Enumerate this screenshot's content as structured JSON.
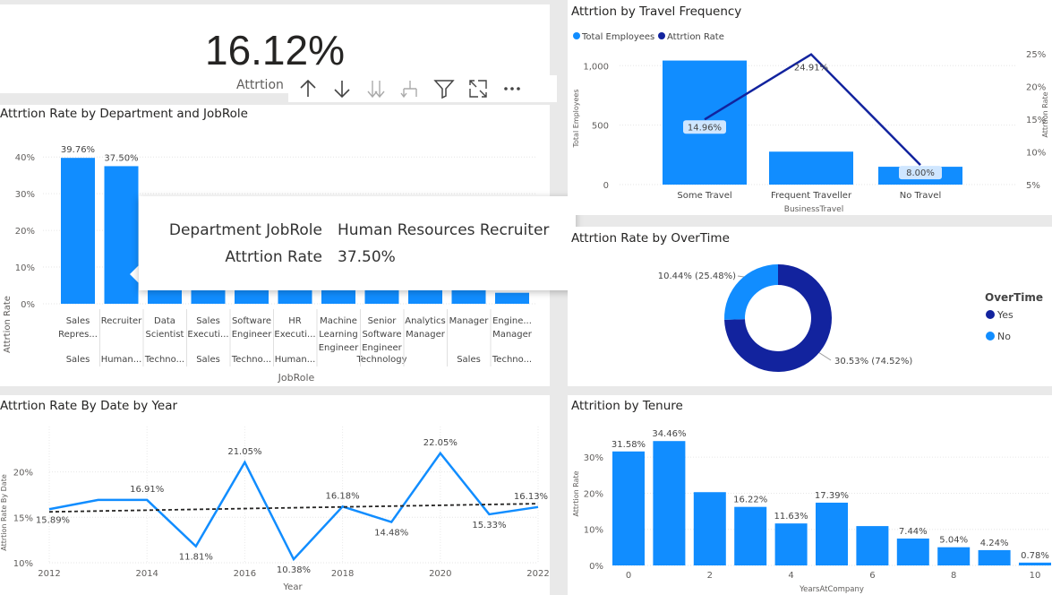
{
  "kpi": {
    "value": "16.12%",
    "label": "Attrtion R"
  },
  "toolbar": {
    "icons": [
      "arrow-up-icon",
      "arrow-down-icon",
      "double-arrow-down-icon",
      "expand-hierarchy-icon",
      "filter-icon",
      "focus-mode-icon",
      "more-options-icon"
    ]
  },
  "dept": {
    "title": "Attrtion Rate by Department and JobRole",
    "yaxis_title": "Attrtion Rate",
    "xaxis_title": "JobRole",
    "yticks": [
      "40%",
      "30%",
      "20%",
      "10%",
      "0%"
    ],
    "roles": [
      [
        "Sales",
        "Repres..."
      ],
      [
        "Recruiter"
      ],
      [
        "Data",
        "Scientist"
      ],
      [
        "Sales",
        "Executi..."
      ],
      [
        "Software",
        "Engineer"
      ],
      [
        "HR",
        "Executi..."
      ],
      [
        "Machine",
        "Learning",
        "Engineer"
      ],
      [
        "Senior",
        "Software",
        "Engineer"
      ],
      [
        "Analytics",
        "Manager"
      ],
      [
        "Manager"
      ],
      [
        "Engine...",
        "Manager"
      ]
    ],
    "departments": [
      "Sales",
      "Human...",
      "Techno...",
      "Sales",
      "Techno...",
      "Human...",
      "",
      "Technology",
      "",
      "Sales",
      "Techno..."
    ],
    "data_labels": [
      "39.76%",
      "37.50%"
    ]
  },
  "tooltip": {
    "key1": "Department JobRole",
    "val1": "Human Resources Recruiter",
    "key2": "Attrtion Rate",
    "val2": "37.50%"
  },
  "travel": {
    "title": "Attrtion by Travel Frequency",
    "legend": [
      "Total Employees",
      "Attrtion Rate"
    ],
    "y1_title": "Total Employees",
    "y2_title": "Attrtion Rate",
    "x_title": "BusinessTravel",
    "y1_ticks": [
      "1,000",
      "500",
      "0"
    ],
    "y2_ticks": [
      "25%",
      "20%",
      "15%",
      "10%",
      "5%"
    ],
    "line_labels": [
      "14.96%",
      "24.91%",
      "8.00%"
    ]
  },
  "overtime": {
    "title": "Attrtion Rate by OverTime",
    "legend_title": "OverTime",
    "legend": [
      "Yes",
      "No"
    ],
    "label_no": "10.44% (25.48%)",
    "label_yes": "30.53% (74.52%)"
  },
  "year": {
    "title": "Attrtion Rate By Date by Year",
    "y_title": "Attrtion Rate By Date",
    "x_title": "Year",
    "yticks": [
      "20%",
      "15%",
      "10%"
    ],
    "xticks": [
      "2012",
      "2014",
      "2016",
      "2018",
      "2020",
      "2022"
    ],
    "point_labels": [
      "15.89%",
      "16.91%",
      "11.81%",
      "21.05%",
      "10.38%",
      "16.18%",
      "14.48%",
      "22.05%",
      "15.33%",
      "16.13%"
    ]
  },
  "tenure": {
    "title": "Attrition by Tenure",
    "y_title": "Attrtion Rate",
    "x_title": "YearsAtCompany",
    "yticks": [
      "30%",
      "20%",
      "10%",
      "0%"
    ],
    "xticks": [
      "0",
      "2",
      "4",
      "6",
      "8",
      "10"
    ],
    "bar_labels": [
      "31.58%",
      "34.46%",
      "",
      "16.22%",
      "11.63%",
      "17.39%",
      "",
      "7.44%",
      "5.04%",
      "4.24%",
      "0.78%"
    ]
  },
  "colors": {
    "bar": "#118dff",
    "dark": "#12239e",
    "trend": "#252423"
  },
  "chart_data": [
    {
      "type": "bar",
      "title": "Attrtion Rate by Department and JobRole",
      "xlabel": "JobRole",
      "ylabel": "Attrtion Rate",
      "categories": [
        "Sales Repres...",
        "Recruiter",
        "Data Scientist",
        "Sales Executi...",
        "Software Engineer",
        "HR Executi...",
        "Machine Learning Engineer",
        "Senior Software Engineer",
        "Analytics Manager",
        "Manager",
        "Engine... Manager"
      ],
      "values": [
        39.76,
        37.5,
        5,
        5,
        5,
        5,
        5,
        5,
        5,
        5,
        3
      ],
      "ylim": [
        0,
        45
      ]
    },
    {
      "type": "bar",
      "title": "Attrtion by Travel Frequency",
      "xlabel": "BusinessTravel",
      "categories": [
        "Some Travel",
        "Frequent Traveller",
        "No Travel"
      ],
      "series": [
        {
          "name": "Total Employees",
          "values": [
            1043,
            277,
            150
          ]
        },
        {
          "name": "Attrtion Rate",
          "values": [
            14.96,
            24.91,
            8.0
          ]
        }
      ],
      "ylim": [
        0,
        1100
      ],
      "y2lim": [
        5,
        27
      ]
    },
    {
      "type": "pie",
      "title": "Attrtion Rate by OverTime",
      "categories": [
        "Yes",
        "No"
      ],
      "values": [
        30.53,
        10.44
      ],
      "percent_of_total": [
        74.52,
        25.48
      ]
    },
    {
      "type": "line",
      "title": "Attrtion Rate By Date by Year",
      "xlabel": "Year",
      "ylabel": "Attrtion Rate By Date",
      "x": [
        2012,
        2013,
        2014,
        2015,
        2016,
        2017,
        2018,
        2019,
        2020,
        2021,
        2022
      ],
      "values": [
        15.89,
        16.91,
        16.91,
        11.81,
        21.05,
        10.38,
        16.18,
        14.48,
        22.05,
        15.33,
        16.13
      ],
      "trend": [
        15.6,
        16.5
      ],
      "ylim": [
        9.5,
        24
      ]
    },
    {
      "type": "bar",
      "title": "Attrition by Tenure",
      "xlabel": "YearsAtCompany",
      "ylabel": "Attrtion Rate",
      "categories": [
        "0",
        "1",
        "2",
        "3",
        "4",
        "5",
        "6",
        "7",
        "8",
        "9",
        "10"
      ],
      "values": [
        31.58,
        34.46,
        20.3,
        16.22,
        11.63,
        17.39,
        10.9,
        7.44,
        5.04,
        4.24,
        0.78
      ],
      "ylim": [
        0,
        36
      ]
    }
  ]
}
